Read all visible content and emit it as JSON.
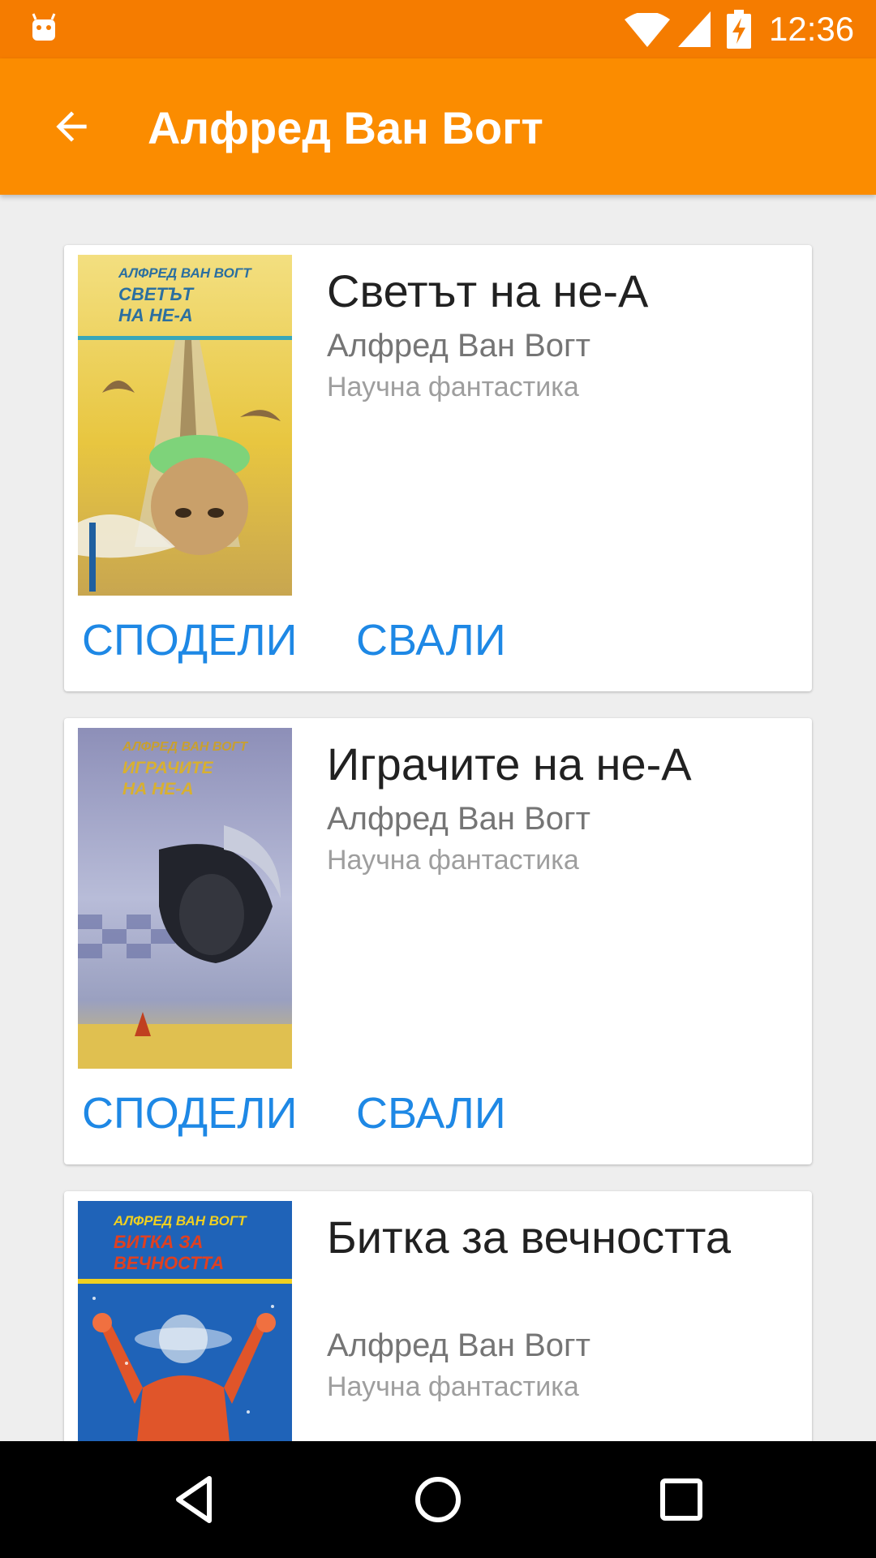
{
  "status_bar": {
    "time": "12:36",
    "icons": [
      "android-icon",
      "wifi-icon",
      "signal-icon",
      "battery-charging-icon"
    ]
  },
  "app_bar": {
    "title": "Алфред Ван Вогт",
    "back_icon": "arrow-back-icon"
  },
  "colors": {
    "status_bar": "#f57c00",
    "app_bar": "#fb8c00",
    "action_text": "#1e88e5",
    "background": "#eeeeee"
  },
  "books": [
    {
      "title": "Светът на не-А",
      "author": "Алфред Ван Вогт",
      "genre": "Научна фантастика",
      "cover_text": {
        "author": "АЛФРЕД ВАН ВОГТ",
        "title_line1": "СВЕТЪТ",
        "title_line2": "НА НЕ-А"
      },
      "share_label": "СПОДЕЛИ",
      "download_label": "СВАЛИ"
    },
    {
      "title": "Играчите на не-А",
      "author": "Алфред Ван Вогт",
      "genre": "Научна фантастика",
      "cover_text": {
        "author": "АЛФРЕД ВАН ВОГТ",
        "title_line1": "ИГРАЧИТЕ",
        "title_line2": "НА НЕ-А"
      },
      "share_label": "СПОДЕЛИ",
      "download_label": "СВАЛИ"
    },
    {
      "title": "Битка за вечността",
      "author": "Алфред Ван Вогт",
      "genre": "Научна фантастика",
      "cover_text": {
        "author": "АЛФРЕД ВАН ВОГТ",
        "title_line1": "БИТКА ЗА",
        "title_line2": "ВЕЧНОСТТА"
      }
    }
  ],
  "nav_bar": {
    "icons": [
      "back-triangle-icon",
      "home-circle-icon",
      "recents-square-icon"
    ]
  }
}
